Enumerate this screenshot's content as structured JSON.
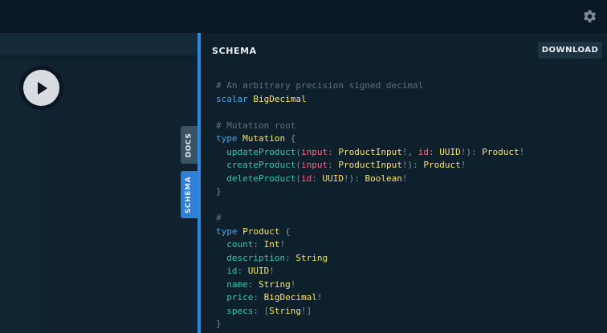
{
  "toolbar": {
    "settings_icon": "gear-icon"
  },
  "editor": {
    "play_icon": "play-icon"
  },
  "tabs": {
    "docs": "DOCS",
    "schema": "SCHEMA"
  },
  "schema_panel": {
    "title": "SCHEMA",
    "download_label": "DOWNLOAD"
  },
  "schema_lines": [
    [
      {
        "t": "# An arbitrary precision signed decimal",
        "c": "cm"
      }
    ],
    [
      {
        "t": "scalar ",
        "c": "kw"
      },
      {
        "t": "BigDecimal",
        "c": "ty"
      }
    ],
    [],
    [
      {
        "t": "# Mutation root",
        "c": "cm"
      }
    ],
    [
      {
        "t": "type ",
        "c": "kw"
      },
      {
        "t": "Mutation",
        "c": "ty"
      },
      {
        "t": " {",
        "c": "pn"
      }
    ],
    [
      {
        "t": "  ",
        "c": "pn"
      },
      {
        "t": "updateProduct",
        "c": "fd"
      },
      {
        "t": "(",
        "c": "pn"
      },
      {
        "t": "input",
        "c": "ar"
      },
      {
        "t": ": ",
        "c": "pn"
      },
      {
        "t": "ProductInput",
        "c": "ty"
      },
      {
        "t": "!, ",
        "c": "pn"
      },
      {
        "t": "id",
        "c": "ar"
      },
      {
        "t": ": ",
        "c": "pn"
      },
      {
        "t": "UUID",
        "c": "ty"
      },
      {
        "t": "!): ",
        "c": "pn"
      },
      {
        "t": "Product",
        "c": "ty"
      },
      {
        "t": "!",
        "c": "pn"
      }
    ],
    [
      {
        "t": "  ",
        "c": "pn"
      },
      {
        "t": "createProduct",
        "c": "fd"
      },
      {
        "t": "(",
        "c": "pn"
      },
      {
        "t": "input",
        "c": "ar"
      },
      {
        "t": ": ",
        "c": "pn"
      },
      {
        "t": "ProductInput",
        "c": "ty"
      },
      {
        "t": "!): ",
        "c": "pn"
      },
      {
        "t": "Product",
        "c": "ty"
      },
      {
        "t": "!",
        "c": "pn"
      }
    ],
    [
      {
        "t": "  ",
        "c": "pn"
      },
      {
        "t": "deleteProduct",
        "c": "fd"
      },
      {
        "t": "(",
        "c": "pn"
      },
      {
        "t": "id",
        "c": "ar"
      },
      {
        "t": ": ",
        "c": "pn"
      },
      {
        "t": "UUID",
        "c": "ty"
      },
      {
        "t": "!): ",
        "c": "pn"
      },
      {
        "t": "Boolean",
        "c": "ty"
      },
      {
        "t": "!",
        "c": "pn"
      }
    ],
    [
      {
        "t": "}",
        "c": "pn"
      }
    ],
    [],
    [
      {
        "t": "#",
        "c": "cm"
      }
    ],
    [
      {
        "t": "type ",
        "c": "kw"
      },
      {
        "t": "Product",
        "c": "ty"
      },
      {
        "t": " {",
        "c": "pn"
      }
    ],
    [
      {
        "t": "  ",
        "c": "pn"
      },
      {
        "t": "count",
        "c": "fd"
      },
      {
        "t": ": ",
        "c": "pn"
      },
      {
        "t": "Int",
        "c": "ty"
      },
      {
        "t": "!",
        "c": "pn"
      }
    ],
    [
      {
        "t": "  ",
        "c": "pn"
      },
      {
        "t": "description",
        "c": "fd"
      },
      {
        "t": ": ",
        "c": "pn"
      },
      {
        "t": "String",
        "c": "ty"
      }
    ],
    [
      {
        "t": "  ",
        "c": "pn"
      },
      {
        "t": "id",
        "c": "fd"
      },
      {
        "t": ": ",
        "c": "pn"
      },
      {
        "t": "UUID",
        "c": "ty"
      },
      {
        "t": "!",
        "c": "pn"
      }
    ],
    [
      {
        "t": "  ",
        "c": "pn"
      },
      {
        "t": "name",
        "c": "fd"
      },
      {
        "t": ": ",
        "c": "pn"
      },
      {
        "t": "String",
        "c": "ty"
      },
      {
        "t": "!",
        "c": "pn"
      }
    ],
    [
      {
        "t": "  ",
        "c": "pn"
      },
      {
        "t": "price",
        "c": "fd"
      },
      {
        "t": ": ",
        "c": "pn"
      },
      {
        "t": "BigDecimal",
        "c": "ty"
      },
      {
        "t": "!",
        "c": "pn"
      }
    ],
    [
      {
        "t": "  ",
        "c": "pn"
      },
      {
        "t": "specs",
        "c": "fd"
      },
      {
        "t": ": [",
        "c": "pn"
      },
      {
        "t": "String",
        "c": "ty"
      },
      {
        "t": "!]",
        "c": "pn"
      }
    ],
    [
      {
        "t": "}",
        "c": "pn"
      }
    ]
  ]
}
